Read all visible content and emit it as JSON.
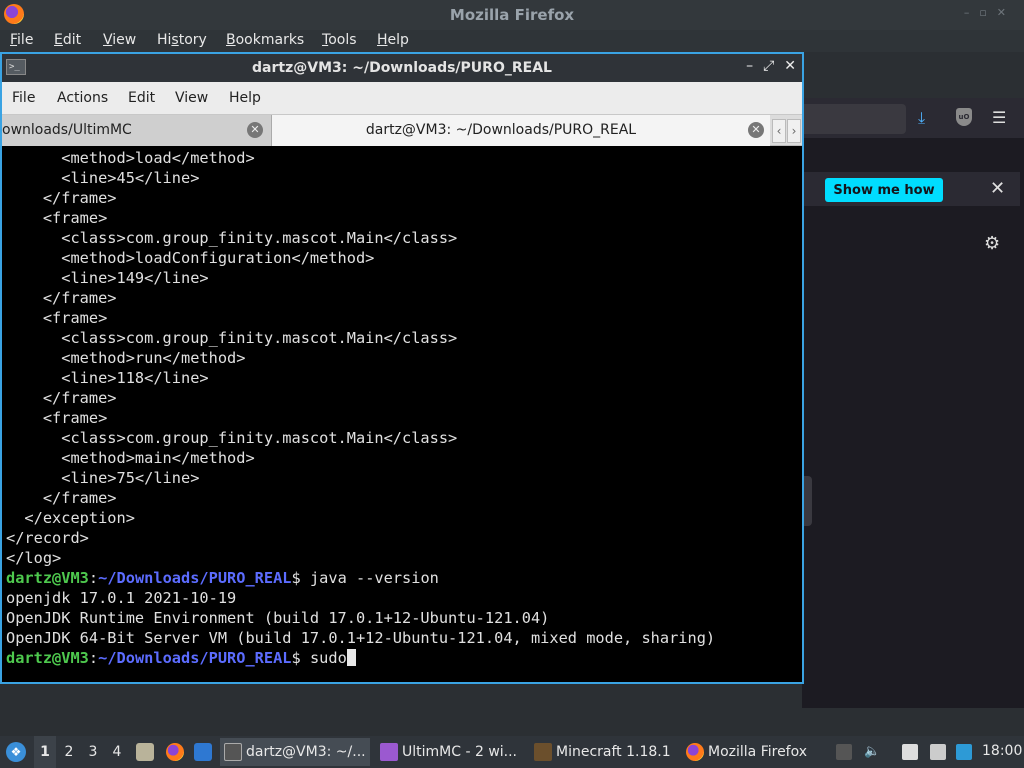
{
  "firefox": {
    "title": "Mozilla Firefox",
    "menu": [
      "File",
      "Edit",
      "View",
      "History",
      "Bookmarks",
      "Tools",
      "Help"
    ],
    "menu_mnemonic_index": [
      0,
      0,
      0,
      2,
      0,
      0,
      0
    ],
    "notice_button": "Show me how",
    "icons": {
      "download": "download-icon",
      "ublock": "ublock-icon",
      "menu": "hamburger-menu-icon",
      "gear": "gear-icon",
      "close": "close-icon"
    },
    "ublock_text": "uO"
  },
  "terminal": {
    "title": "dartz@VM3: ~/Downloads/PURO_REAL",
    "icon_text": ">_",
    "menu": [
      "File",
      "Actions",
      "Edit",
      "View",
      "Help"
    ],
    "tabs": [
      {
        "label": "ownloads/UltimMC",
        "active": false
      },
      {
        "label": "dartz@VM3: ~/Downloads/PURO_REAL",
        "active": true
      }
    ],
    "lines": [
      {
        "text": "      <method>load</method>"
      },
      {
        "text": "      <line>45</line>"
      },
      {
        "text": "    </frame>"
      },
      {
        "text": "    <frame>"
      },
      {
        "text": "      <class>com.group_finity.mascot.Main</class>"
      },
      {
        "text": "      <method>loadConfiguration</method>"
      },
      {
        "text": "      <line>149</line>"
      },
      {
        "text": "    </frame>"
      },
      {
        "text": "    <frame>"
      },
      {
        "text": "      <class>com.group_finity.mascot.Main</class>"
      },
      {
        "text": "      <method>run</method>"
      },
      {
        "text": "      <line>118</line>"
      },
      {
        "text": "    </frame>"
      },
      {
        "text": "    <frame>"
      },
      {
        "text": "      <class>com.group_finity.mascot.Main</class>"
      },
      {
        "text": "      <method>main</method>"
      },
      {
        "text": "      <line>75</line>"
      },
      {
        "text": "    </frame>"
      },
      {
        "text": "  </exception>"
      },
      {
        "text": "</record>"
      },
      {
        "text": "</log>"
      },
      {
        "prompt": true,
        "user": "dartz@VM3",
        "path": "~/Downloads/PURO_REAL",
        "cmd": " java --version"
      },
      {
        "text": "openjdk 17.0.1 2021-10-19"
      },
      {
        "text": "OpenJDK Runtime Environment (build 17.0.1+12-Ubuntu-121.04)"
      },
      {
        "text": "OpenJDK 64-Bit Server VM (build 17.0.1+12-Ubuntu-121.04, mixed mode, sharing)"
      },
      {
        "prompt": true,
        "user": "dartz@VM3",
        "path": "~/Downloads/PURO_REAL",
        "cmd": " sudo",
        "cursor": true
      }
    ],
    "colors": {
      "user": "#4ec94e",
      "path": "#5c6cff",
      "text": "#e0e0e0",
      "background": "#000000",
      "border": "#3aa3e3"
    }
  },
  "taskbar": {
    "workspaces": [
      "1",
      "2",
      "3",
      "4"
    ],
    "active_workspace": "1",
    "tasks": [
      {
        "label": "dartz@VM3: ~/...",
        "active": true
      },
      {
        "label": "UltimMC - 2 wi..."
      },
      {
        "label": "Minecraft 1.18.1"
      },
      {
        "label": "Mozilla Firefox"
      }
    ],
    "clock": "18:00"
  }
}
